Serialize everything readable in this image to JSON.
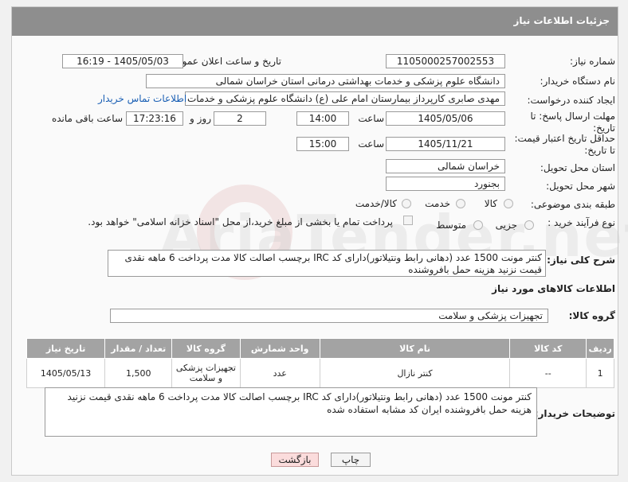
{
  "header": {
    "title": "جزئیات اطلاعات نیاز"
  },
  "fields": {
    "need_number_label": "شماره نیاز:",
    "need_number": "1105000257002553",
    "announce_datetime_label": "تاریخ و ساعت اعلان عمومی:",
    "announce_datetime": "1405/05/03 - 16:19",
    "buyer_org_label": "نام دستگاه خریدار:",
    "buyer_org": "دانشگاه علوم پزشکی و خدمات بهداشتی درمانی استان خراسان شمالی",
    "requester_label": "ایجاد کننده درخواست:",
    "requester": "مهدی صابری کارپرداز بیمارستان امام علی (ع) دانشگاه علوم پزشکی و خدمات بهداشتی",
    "buyer_contact_link": "اطلاعات تماس خریدار",
    "reply_deadline_label": "مهلت ارسال پاسخ: تا تاریخ:",
    "reply_date": "1405/05/06",
    "time_label": "ساعت",
    "reply_time": "14:00",
    "days_value": "2",
    "days_label": "روز و",
    "remaining_time": "17:23:16",
    "remaining_label": "ساعت باقی مانده",
    "price_validity_label": "حداقل تاریخ اعتبار قیمت: تا تاریخ:",
    "validity_date": "1405/11/21",
    "validity_time_label": "ساعت",
    "validity_time": "15:00",
    "province_label": "استان محل تحویل:",
    "province": "خراسان شمالی",
    "city_label": "شهر محل تحویل:",
    "city": "بجنورد",
    "category_label": "طبقه بندی موضوعی:",
    "category_options": [
      "کالا",
      "خدمت",
      "کالا/خدمت"
    ],
    "purchase_type_label": "نوع فرآیند خرید :",
    "purchase_options": [
      "جزیی",
      "متوسط"
    ],
    "payment_note": "پرداخت تمام یا بخشی از مبلغ خرید،از محل \"اسناد خزانه اسلامی\" خواهد بود.",
    "overall_desc_label": "شرح کلی نیاز:",
    "overall_desc": "کنتر مونت 1500 عدد (دهانی رابط ونتیلاتور)دارای کد IRC برچسب اصالت کالا مدت پرداخت 6 ماهه نقدی قیمت نزنید هزینه حمل بافروشنده"
  },
  "goods_section": {
    "title": "اطلاعات کالاهای مورد نیاز",
    "group_label": "گروه کالا:",
    "group_value": "تجهیزات پزشکی و سلامت"
  },
  "table": {
    "headers": [
      "ردیف",
      "کد کالا",
      "نام کالا",
      "واحد شمارش",
      "گروه کالا",
      "تعداد / مقدار",
      "تاریخ نیاز"
    ],
    "rows": [
      [
        "1",
        "--",
        "کنتر نازال",
        "عدد",
        "تجهیزات پزشکی و سلامت",
        "1,500",
        "1405/05/13"
      ]
    ]
  },
  "buyer_notes": {
    "label": "توضیحات خریدار:",
    "text": "کنتر مونت 1500 عدد (دهانی رابط ونتیلاتور)دارای کد IRC برچسب اصالت کالا مدت پرداخت 6 ماهه نقدی قیمت نزنید هزینه حمل بافروشنده ایران کد مشابه استفاده شده"
  },
  "buttons": {
    "print": "چاپ",
    "back": "بازگشت"
  },
  "watermark": "AriaTender.net"
}
